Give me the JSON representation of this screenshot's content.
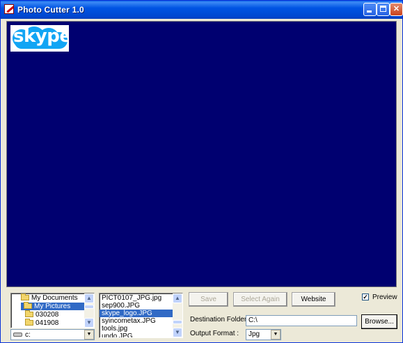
{
  "window": {
    "title": "Photo Cutter 1.0",
    "accent_color": "#0054e3",
    "preview_background": "#000070",
    "preview_logo_text": "skype"
  },
  "folders": {
    "items": [
      {
        "label": "My Documents",
        "selected": false
      },
      {
        "label": "My Pictures",
        "selected": true
      },
      {
        "label": "030208",
        "selected": false
      },
      {
        "label": "041908",
        "selected": false
      }
    ]
  },
  "files": {
    "items": [
      {
        "label": "PICT0107_JPG.jpg",
        "selected": false
      },
      {
        "label": "sep900.JPG",
        "selected": false
      },
      {
        "label": "skype_logo.JPG",
        "selected": true
      },
      {
        "label": "syincometax.JPG",
        "selected": false
      },
      {
        "label": "tools.jpg",
        "selected": false
      },
      {
        "label": "undo.JPG",
        "selected": false
      }
    ]
  },
  "drive": {
    "value": "c:"
  },
  "buttons": {
    "save": "Save",
    "select_again": "Select Again",
    "website": "Website",
    "browse": "Browse..."
  },
  "preview_option": {
    "label": "Preview",
    "checked": true
  },
  "destination": {
    "label": "Destination Folder :",
    "value": "C:\\"
  },
  "output_format": {
    "label": "Output Format :",
    "value": "Jpg"
  },
  "icons": {
    "app": "photo-cutter-icon",
    "minimize": "minimize-icon",
    "maximize": "maximize-icon",
    "close": "close-icon",
    "folder": "folder-icon",
    "drive": "hard-drive-icon"
  }
}
